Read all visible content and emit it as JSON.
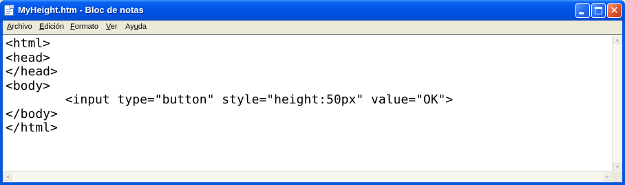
{
  "window": {
    "title": "MyHeight.htm - Bloc de notas",
    "icon": "notepad-icon"
  },
  "controls": {
    "minimize_icon": "minimize-icon",
    "maximize_icon": "maximize-icon",
    "close_glyph": "✕"
  },
  "menu": {
    "items": [
      {
        "mnemonic": "A",
        "rest": "rchivo"
      },
      {
        "mnemonic": "E",
        "rest": "dición"
      },
      {
        "mnemonic": "F",
        "rest": "ormato"
      },
      {
        "mnemonic": "V",
        "rest": "er"
      },
      {
        "mnemonic": "",
        "pre": "Ay",
        "mnemonic2": "u",
        "rest": "da"
      }
    ]
  },
  "editor": {
    "content": "<html>\n<head>\n</head>\n<body>\n        <input type=\"button\" style=\"height:50px\" value=\"OK\">\n</body>\n</html>"
  },
  "colors": {
    "titlebar": "#0055e5",
    "close_button": "#e3582f",
    "chrome": "#ece9d8"
  }
}
